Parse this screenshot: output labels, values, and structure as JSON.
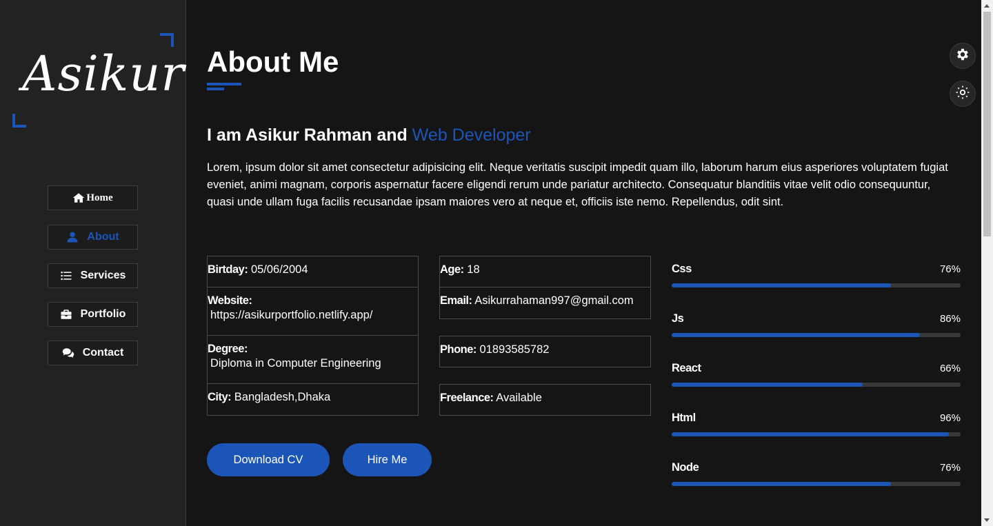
{
  "logo": {
    "text": "Asikur"
  },
  "nav": {
    "items": [
      {
        "label": "Home",
        "icon": "home-icon",
        "active": false
      },
      {
        "label": "About",
        "icon": "user-icon",
        "active": true
      },
      {
        "label": "Services",
        "icon": "list-icon",
        "active": false
      },
      {
        "label": "Portfolio",
        "icon": "briefcase-icon",
        "active": false
      },
      {
        "label": "Contact",
        "icon": "comments-icon",
        "active": false
      }
    ]
  },
  "about": {
    "title": "About Me",
    "intro_prefix": "I am Asikur Rahman and ",
    "intro_accent": "Web Developer",
    "bio": "Lorem, ipsum dolor sit amet consectetur adipisicing elit. Neque veritatis suscipit impedit quam illo, laborum harum eius asperiores voluptatem fugiat eveniet, animi magnam, corporis aspernatur facere eligendi rerum unde pariatur architecto. Consequatur blanditiis vitae velit odio consequuntur, quasi unde ullam fuga facilis recusandae ipsam maiores vero at neque et, officiis iste nemo. Repellendus, odit sint."
  },
  "info_left": [
    {
      "label": "Birtday:",
      "value": "05/06/2004"
    },
    {
      "label": "Website:",
      "value": "https://asikurportfolio.netlify.app/"
    },
    {
      "label": "Degree:",
      "value": "Diploma in Computer Engineering"
    },
    {
      "label": "City:",
      "value": "Bangladesh,Dhaka"
    }
  ],
  "info_right": [
    {
      "label": "Age:",
      "value": "18"
    },
    {
      "label": "Email:",
      "value": "Asikurrahaman997@gmail.com"
    },
    {
      "label": "Phone:",
      "value": "01893585782"
    },
    {
      "label": "Freelance:",
      "value": "Available"
    }
  ],
  "buttons": {
    "download": "Download CV",
    "hire": "Hire Me"
  },
  "skills": [
    {
      "name": "Css",
      "percent_label": "76%",
      "percent": 76
    },
    {
      "name": "Js",
      "percent_label": "86%",
      "percent": 86
    },
    {
      "name": "React",
      "percent_label": "66%",
      "percent": 66
    },
    {
      "name": "Html",
      "percent_label": "96%",
      "percent": 96
    },
    {
      "name": "Node",
      "percent_label": "76%",
      "percent": 76
    }
  ],
  "controls": {
    "settings_icon": "gear-icon",
    "theme_icon": "sun-icon"
  },
  "colors": {
    "accent": "#1b55b8",
    "background": "#151515",
    "sidebar": "#222222"
  }
}
